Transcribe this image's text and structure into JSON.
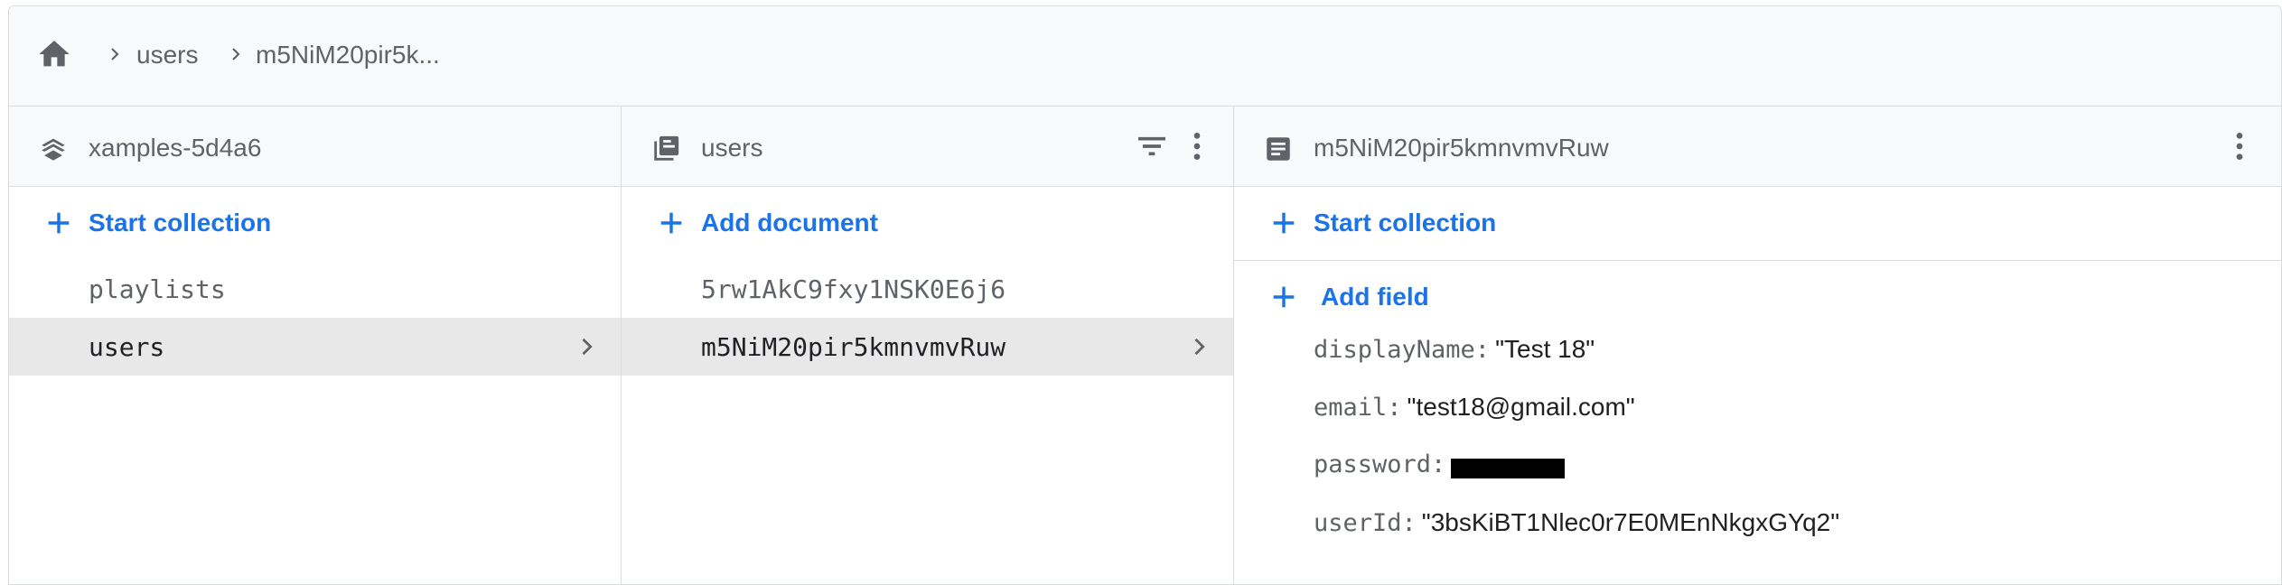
{
  "breadcrumb": {
    "home_icon": "home-icon",
    "items": [
      "users",
      "m5NiM20pir5k..."
    ]
  },
  "columns": {
    "project": {
      "title": "xamples-5d4a6",
      "icon": "firestore-stack-icon",
      "action_label": "Start collection",
      "items": [
        {
          "label": "playlists",
          "selected": false
        },
        {
          "label": "users",
          "selected": true
        }
      ]
    },
    "collection": {
      "title": "users",
      "icon": "collection-icon",
      "action_label": "Add document",
      "items": [
        {
          "label": "5rw1AkC9fxy1NSK0E6j6",
          "selected": false
        },
        {
          "label": "m5NiM20pir5kmnvmvRuw",
          "selected": true
        }
      ]
    },
    "document": {
      "title": "m5NiM20pir5kmnvmvRuw",
      "icon": "document-icon",
      "start_collection_label": "Start collection",
      "add_field_label": "Add field",
      "fields": [
        {
          "key": "displayName:",
          "value": "\"Test 18\""
        },
        {
          "key": "email:",
          "value": "\"test18@gmail.com\""
        },
        {
          "key": "password:",
          "value": ""
        },
        {
          "key": "userId:",
          "value": "\"3bsKiBT1Nlec0r7E0MEnNkgxGYq2\""
        }
      ]
    }
  },
  "colors": {
    "accent": "#1a73e8",
    "header_bg": "#f8f9fa",
    "selected_bg": "#e8e8e8",
    "border": "#dadce0"
  }
}
